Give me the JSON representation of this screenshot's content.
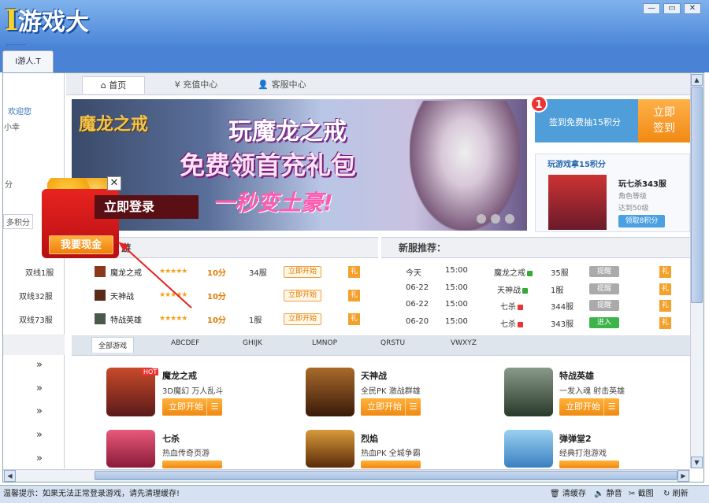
{
  "window": {
    "logo_text": "游戏大厅",
    "logo_prefix": "I",
    "min": "—",
    "max": "▭",
    "close": "✕"
  },
  "main_tab": "I游人.T",
  "nav": {
    "home": "首页",
    "recharge": "充值中心",
    "service": "客服中心"
  },
  "left": {
    "welcome": "欢迎您",
    "user": "小幸",
    "points": "分",
    "more": "多积分"
  },
  "banner": {
    "logo": "魔龙之戒",
    "line1": "玩魔龙之戒",
    "line2": "免费领首充礼包",
    "line3": "一秒变土豪!"
  },
  "checkin": {
    "text": "签到免费抽15积分",
    "button_line1": "立即",
    "button_line2": "签到",
    "badge": "1"
  },
  "play_earn": {
    "heading": "玩游戏拿15积分",
    "game": "玩七杀343服",
    "sub1": "角色等级",
    "sub2": "达到50级",
    "button": "领取8积分"
  },
  "popup": {
    "close": "✕",
    "cash_button": "我要现金",
    "login_banner": "立即登录"
  },
  "sections": {
    "hot_suffix": "游",
    "new_servers": "新服推荐："
  },
  "left_servers": [
    "双线1服",
    "双线32服",
    "双线73服"
  ],
  "hot_games": [
    {
      "name": "魔龙之戒",
      "stars": "★★★★★",
      "score": "10分",
      "server": "34服",
      "button": "立即开始",
      "gift": "礼"
    },
    {
      "name": "天神战",
      "stars": "★★★★★",
      "score": "10分",
      "server": "",
      "button": "立即开始",
      "gift": "礼"
    },
    {
      "name": "特战英雄",
      "stars": "★★★★★",
      "score": "10分",
      "server": "1服",
      "button": "立即开始",
      "gift": "礼"
    }
  ],
  "new_servers": [
    {
      "date": "今天",
      "time": "15:00",
      "game": "魔龙之戒",
      "server": "35服",
      "action": "提醒",
      "gift": "礼"
    },
    {
      "date": "06-22",
      "time": "15:00",
      "game": "天神战",
      "server": "1服",
      "action": "提醒",
      "gift": "礼"
    },
    {
      "date": "06-22",
      "time": "15:00",
      "game": "七杀",
      "server": "344服",
      "action": "提醒",
      "gift": "礼"
    },
    {
      "date": "06-20",
      "time": "15:00",
      "game": "七杀",
      "server": "343服",
      "action": "进入",
      "gift": "礼"
    }
  ],
  "filters": [
    "全部游戏",
    "ABCDEF",
    "GHIJK",
    "LMNOP",
    "QRSTU",
    "VWXYZ"
  ],
  "chevrons": [
    "»",
    "»",
    "»",
    "»",
    "»"
  ],
  "games": [
    {
      "name": "魔龙之戒",
      "desc": "3D魔幻 万人乱斗",
      "button": "立即开始",
      "hot": "HOT",
      "color": "#8b2a1c"
    },
    {
      "name": "天神战",
      "desc": "全民PK 激战群雄",
      "button": "立即开始",
      "color": "#5a3a1a"
    },
    {
      "name": "特战英雄",
      "desc": "一发入魂 射击英雄",
      "button": "立即开始",
      "color": "#3a4a3a"
    },
    {
      "name": "七杀",
      "desc": "热血传奇页游",
      "button": "立即开始",
      "color": "#c0385a"
    },
    {
      "name": "烈焰",
      "desc": "热血PK 全城争霸",
      "button": "立即开始",
      "color": "#7a4a1a"
    },
    {
      "name": "弹弹堂2",
      "desc": "经典打泡游戏",
      "button": "立即开始",
      "color": "#5aa0d8"
    }
  ],
  "status": {
    "tip": "温馨提示：如果无法正常登录游戏，请先清理缓存!",
    "clear": "清缓存",
    "mute": "静音",
    "screenshot": "截图",
    "refresh": "刷新"
  }
}
